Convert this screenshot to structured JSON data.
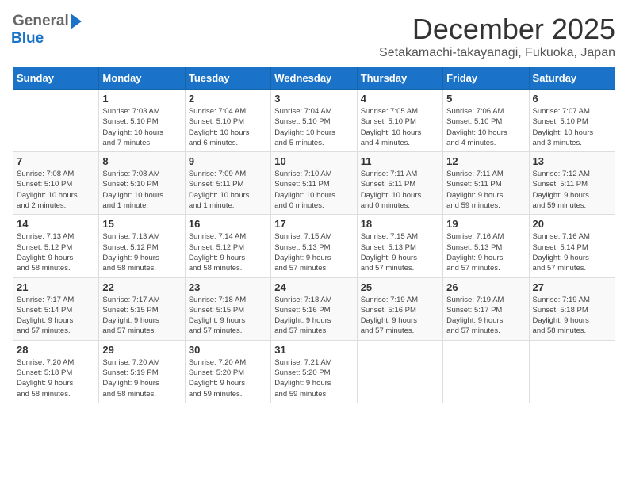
{
  "header": {
    "logo_general": "General",
    "logo_blue": "Blue",
    "month_title": "December 2025",
    "subtitle": "Setakamachi-takayanagi, Fukuoka, Japan"
  },
  "weekdays": [
    "Sunday",
    "Monday",
    "Tuesday",
    "Wednesday",
    "Thursday",
    "Friday",
    "Saturday"
  ],
  "weeks": [
    [
      {
        "day": "",
        "info": ""
      },
      {
        "day": "1",
        "info": "Sunrise: 7:03 AM\nSunset: 5:10 PM\nDaylight: 10 hours\nand 7 minutes."
      },
      {
        "day": "2",
        "info": "Sunrise: 7:04 AM\nSunset: 5:10 PM\nDaylight: 10 hours\nand 6 minutes."
      },
      {
        "day": "3",
        "info": "Sunrise: 7:04 AM\nSunset: 5:10 PM\nDaylight: 10 hours\nand 5 minutes."
      },
      {
        "day": "4",
        "info": "Sunrise: 7:05 AM\nSunset: 5:10 PM\nDaylight: 10 hours\nand 4 minutes."
      },
      {
        "day": "5",
        "info": "Sunrise: 7:06 AM\nSunset: 5:10 PM\nDaylight: 10 hours\nand 4 minutes."
      },
      {
        "day": "6",
        "info": "Sunrise: 7:07 AM\nSunset: 5:10 PM\nDaylight: 10 hours\nand 3 minutes."
      }
    ],
    [
      {
        "day": "7",
        "info": "Sunrise: 7:08 AM\nSunset: 5:10 PM\nDaylight: 10 hours\nand 2 minutes."
      },
      {
        "day": "8",
        "info": "Sunrise: 7:08 AM\nSunset: 5:10 PM\nDaylight: 10 hours\nand 1 minute."
      },
      {
        "day": "9",
        "info": "Sunrise: 7:09 AM\nSunset: 5:11 PM\nDaylight: 10 hours\nand 1 minute."
      },
      {
        "day": "10",
        "info": "Sunrise: 7:10 AM\nSunset: 5:11 PM\nDaylight: 10 hours\nand 0 minutes."
      },
      {
        "day": "11",
        "info": "Sunrise: 7:11 AM\nSunset: 5:11 PM\nDaylight: 10 hours\nand 0 minutes."
      },
      {
        "day": "12",
        "info": "Sunrise: 7:11 AM\nSunset: 5:11 PM\nDaylight: 9 hours\nand 59 minutes."
      },
      {
        "day": "13",
        "info": "Sunrise: 7:12 AM\nSunset: 5:11 PM\nDaylight: 9 hours\nand 59 minutes."
      }
    ],
    [
      {
        "day": "14",
        "info": "Sunrise: 7:13 AM\nSunset: 5:12 PM\nDaylight: 9 hours\nand 58 minutes."
      },
      {
        "day": "15",
        "info": "Sunrise: 7:13 AM\nSunset: 5:12 PM\nDaylight: 9 hours\nand 58 minutes."
      },
      {
        "day": "16",
        "info": "Sunrise: 7:14 AM\nSunset: 5:12 PM\nDaylight: 9 hours\nand 58 minutes."
      },
      {
        "day": "17",
        "info": "Sunrise: 7:15 AM\nSunset: 5:13 PM\nDaylight: 9 hours\nand 57 minutes."
      },
      {
        "day": "18",
        "info": "Sunrise: 7:15 AM\nSunset: 5:13 PM\nDaylight: 9 hours\nand 57 minutes."
      },
      {
        "day": "19",
        "info": "Sunrise: 7:16 AM\nSunset: 5:13 PM\nDaylight: 9 hours\nand 57 minutes."
      },
      {
        "day": "20",
        "info": "Sunrise: 7:16 AM\nSunset: 5:14 PM\nDaylight: 9 hours\nand 57 minutes."
      }
    ],
    [
      {
        "day": "21",
        "info": "Sunrise: 7:17 AM\nSunset: 5:14 PM\nDaylight: 9 hours\nand 57 minutes."
      },
      {
        "day": "22",
        "info": "Sunrise: 7:17 AM\nSunset: 5:15 PM\nDaylight: 9 hours\nand 57 minutes."
      },
      {
        "day": "23",
        "info": "Sunrise: 7:18 AM\nSunset: 5:15 PM\nDaylight: 9 hours\nand 57 minutes."
      },
      {
        "day": "24",
        "info": "Sunrise: 7:18 AM\nSunset: 5:16 PM\nDaylight: 9 hours\nand 57 minutes."
      },
      {
        "day": "25",
        "info": "Sunrise: 7:19 AM\nSunset: 5:16 PM\nDaylight: 9 hours\nand 57 minutes."
      },
      {
        "day": "26",
        "info": "Sunrise: 7:19 AM\nSunset: 5:17 PM\nDaylight: 9 hours\nand 57 minutes."
      },
      {
        "day": "27",
        "info": "Sunrise: 7:19 AM\nSunset: 5:18 PM\nDaylight: 9 hours\nand 58 minutes."
      }
    ],
    [
      {
        "day": "28",
        "info": "Sunrise: 7:20 AM\nSunset: 5:18 PM\nDaylight: 9 hours\nand 58 minutes."
      },
      {
        "day": "29",
        "info": "Sunrise: 7:20 AM\nSunset: 5:19 PM\nDaylight: 9 hours\nand 58 minutes."
      },
      {
        "day": "30",
        "info": "Sunrise: 7:20 AM\nSunset: 5:20 PM\nDaylight: 9 hours\nand 59 minutes."
      },
      {
        "day": "31",
        "info": "Sunrise: 7:21 AM\nSunset: 5:20 PM\nDaylight: 9 hours\nand 59 minutes."
      },
      {
        "day": "",
        "info": ""
      },
      {
        "day": "",
        "info": ""
      },
      {
        "day": "",
        "info": ""
      }
    ]
  ]
}
